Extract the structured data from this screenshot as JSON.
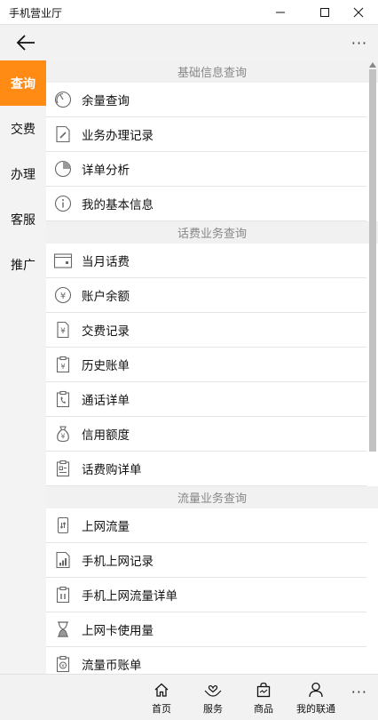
{
  "window": {
    "title": "手机营业厅"
  },
  "appbar": {
    "more_label": "···"
  },
  "sidebar": {
    "items": [
      {
        "label": "查询"
      },
      {
        "label": "交费"
      },
      {
        "label": "办理"
      },
      {
        "label": "客服"
      },
      {
        "label": "推广"
      }
    ]
  },
  "sections": [
    {
      "header": "基础信息查询",
      "items": [
        {
          "label": "余量查询",
          "icon": "gauge-icon"
        },
        {
          "label": "业务办理记录",
          "icon": "document-edit-icon"
        },
        {
          "label": "详单分析",
          "icon": "pie-chart-icon"
        },
        {
          "label": "我的基本信息",
          "icon": "info-icon"
        }
      ]
    },
    {
      "header": "话费业务查询",
      "items": [
        {
          "label": "当月话费",
          "icon": "calendar-icon"
        },
        {
          "label": "账户余额",
          "icon": "yuan-circle-icon"
        },
        {
          "label": "交费记录",
          "icon": "yuan-document-icon"
        },
        {
          "label": "历史账单",
          "icon": "clipboard-yuan-icon"
        },
        {
          "label": "通话详单",
          "icon": "clipboard-phone-icon"
        },
        {
          "label": "信用额度",
          "icon": "money-bag-icon"
        },
        {
          "label": "话费购详单",
          "icon": "clipboard-list-icon"
        }
      ]
    },
    {
      "header": "流量业务查询",
      "items": [
        {
          "label": "上网流量",
          "icon": "phone-data-icon"
        },
        {
          "label": "手机上网记录",
          "icon": "signal-bars-icon"
        },
        {
          "label": "手机上网流量详单",
          "icon": "clipboard-bars-icon"
        },
        {
          "label": "上网卡使用量",
          "icon": "hourglass-icon"
        },
        {
          "label": "流量币账单",
          "icon": "clipboard-coin-icon"
        }
      ]
    }
  ],
  "bottom_nav": {
    "tabs": [
      {
        "label": "首页",
        "icon": "home-icon"
      },
      {
        "label": "服务",
        "icon": "service-hands-icon"
      },
      {
        "label": "商品",
        "icon": "shopping-bag-icon"
      },
      {
        "label": "我的联通",
        "icon": "person-icon"
      }
    ],
    "more_label": "···"
  }
}
